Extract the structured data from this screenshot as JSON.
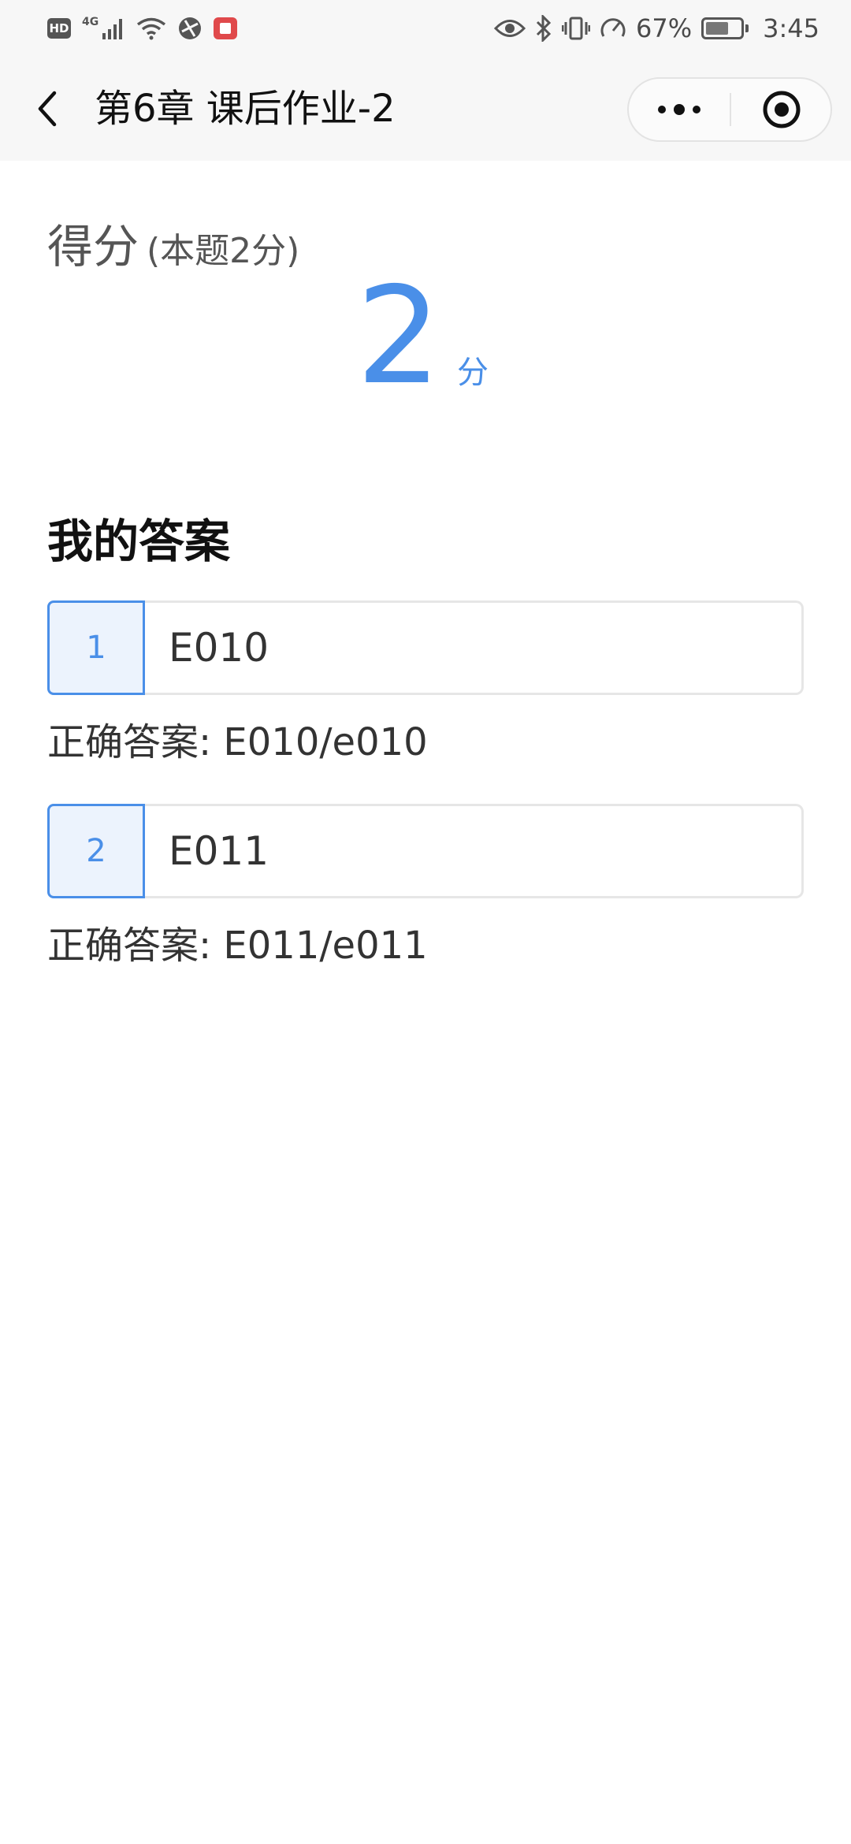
{
  "status_bar": {
    "hd_label": "HD",
    "network_label": "4G",
    "battery_percent": "67%",
    "battery_level": 0.67,
    "time": "3:45",
    "icons": [
      "hd-icon",
      "signal-icon",
      "wifi-icon",
      "vpn-icon",
      "app-notification-icon",
      "eye-icon",
      "bluetooth-icon",
      "vibrate-icon",
      "speed-icon",
      "battery-icon"
    ]
  },
  "nav": {
    "title": "第6章 课后作业-2",
    "back_icon": "chevron-left-icon",
    "more_icon": "more-dots-icon",
    "close_icon": "target-close-icon"
  },
  "score": {
    "label": "得分",
    "note": "(本题2分)",
    "value": "2",
    "unit": "分"
  },
  "answers": {
    "heading": "我的答案",
    "items": [
      {
        "index": "1",
        "my_answer": "E010",
        "correct_text": "正确答案: E010/e010"
      },
      {
        "index": "2",
        "my_answer": "E011",
        "correct_text": "正确答案: E011/e011"
      }
    ]
  },
  "colors": {
    "accent": "#4a8fe8",
    "accent_bg": "#ecf3fd",
    "bar_bg": "#f7f7f7"
  }
}
